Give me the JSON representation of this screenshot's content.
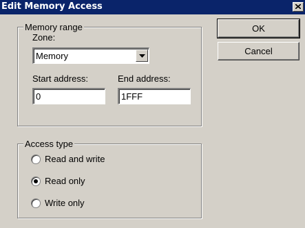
{
  "window": {
    "title": "Edit Memory Access"
  },
  "memory_range": {
    "legend": "Memory range",
    "zone_label": "Zone:",
    "zone_value": "Memory",
    "start_label": "Start address:",
    "start_value": "0",
    "end_label": "End address:",
    "end_value": "1FFF"
  },
  "access_type": {
    "legend": "Access type",
    "options": [
      {
        "label": "Read and write",
        "selected": false
      },
      {
        "label": "Read only",
        "selected": true
      },
      {
        "label": "Write only",
        "selected": false
      }
    ]
  },
  "buttons": {
    "ok": "OK",
    "cancel": "Cancel"
  }
}
